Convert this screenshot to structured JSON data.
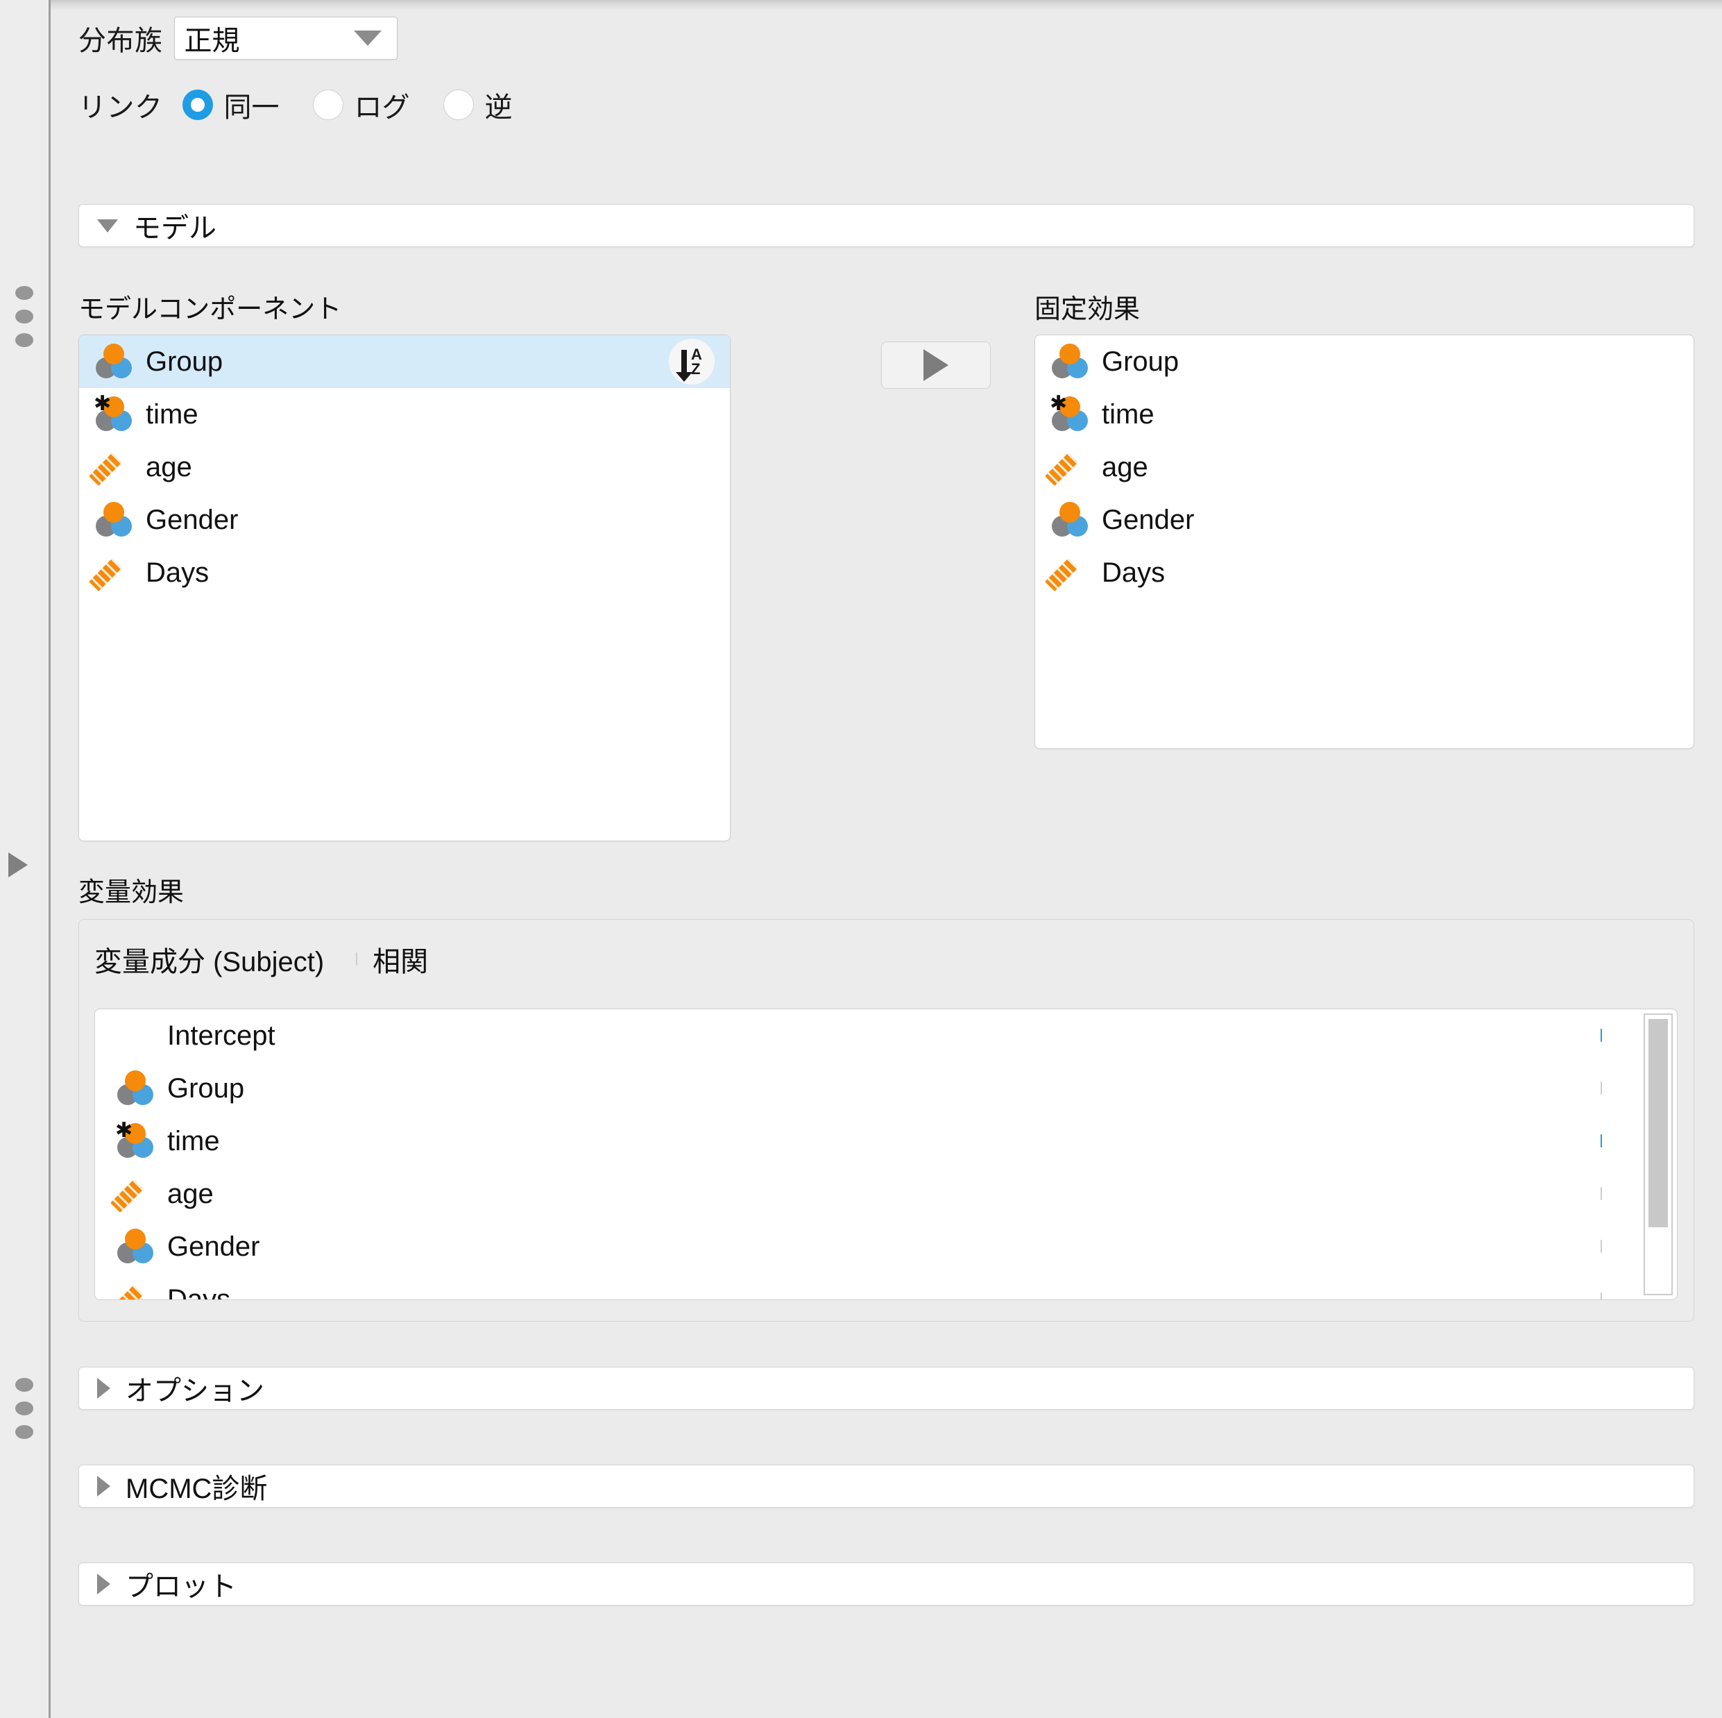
{
  "distribution": {
    "label": "分布族",
    "value": "正規",
    "arrow_icon": "chevron-down-icon"
  },
  "link": {
    "label": "リンク",
    "options": [
      {
        "label": "同一",
        "checked": true
      },
      {
        "label": "ログ",
        "checked": false
      },
      {
        "label": "逆",
        "checked": false
      }
    ]
  },
  "sections": [
    {
      "key": "model",
      "title": "モデル",
      "expanded": true,
      "arrow_icon": "triangle-down-icon"
    },
    {
      "key": "options",
      "title": "オプション",
      "expanded": false,
      "arrow_icon": "triangle-right-icon"
    },
    {
      "key": "mcmc",
      "title": "MCMC診断",
      "expanded": false,
      "arrow_icon": "triangle-right-icon"
    },
    {
      "key": "plots",
      "title": "プロット",
      "expanded": false,
      "arrow_icon": "triangle-right-icon"
    }
  ],
  "model_components": {
    "caption": "モデルコンポーネント",
    "sort_button": {
      "icon": "sort-az-icon",
      "letters_top": "A",
      "letters_bottom": "Z"
    },
    "items": [
      {
        "label": "Group",
        "icon": "nominal-icon",
        "selected": true
      },
      {
        "label": "time",
        "icon": "nominal-text-icon",
        "selected": false
      },
      {
        "label": "age",
        "icon": "scale-ruler-icon",
        "selected": false
      },
      {
        "label": "Gender",
        "icon": "nominal-icon",
        "selected": false
      },
      {
        "label": "Days",
        "icon": "scale-ruler-icon",
        "selected": false
      }
    ]
  },
  "transfer_button": {
    "icon": "play-triangle-right-icon"
  },
  "fixed_effects": {
    "caption": "固定効果",
    "items": [
      {
        "label": "Group",
        "icon": "nominal-icon"
      },
      {
        "label": "time",
        "icon": "nominal-text-icon"
      },
      {
        "label": "age",
        "icon": "scale-ruler-icon"
      },
      {
        "label": "Gender",
        "icon": "nominal-icon"
      },
      {
        "label": "Days",
        "icon": "scale-ruler-icon"
      }
    ]
  },
  "random_effects": {
    "caption": "変量効果",
    "component_label": "変量成分 (Subject)",
    "correlation_label": "相関",
    "correlation_checked": false,
    "items": [
      {
        "label": "Intercept",
        "icon": "none",
        "checked": true
      },
      {
        "label": "Group",
        "icon": "nominal-icon",
        "checked": false
      },
      {
        "label": "time",
        "icon": "nominal-text-icon",
        "checked": true
      },
      {
        "label": "age",
        "icon": "scale-ruler-icon",
        "checked": false
      },
      {
        "label": "Gender",
        "icon": "nominal-icon",
        "checked": false
      },
      {
        "label": "Days",
        "icon": "scale-ruler-icon",
        "checked": false
      }
    ]
  },
  "gutter": {
    "drag_handles": [
      "drag-dots-icon",
      "drag-dots-icon"
    ],
    "expand_icon": "triangle-right-icon"
  },
  "colors": {
    "accent": "#1e9ce4",
    "nominal_orange": "#f58a0b",
    "nominal_gray": "#808285",
    "nominal_blue": "#4ba3dd",
    "selection": "#d6ebf9",
    "panel_bg": "#ebebeb"
  }
}
